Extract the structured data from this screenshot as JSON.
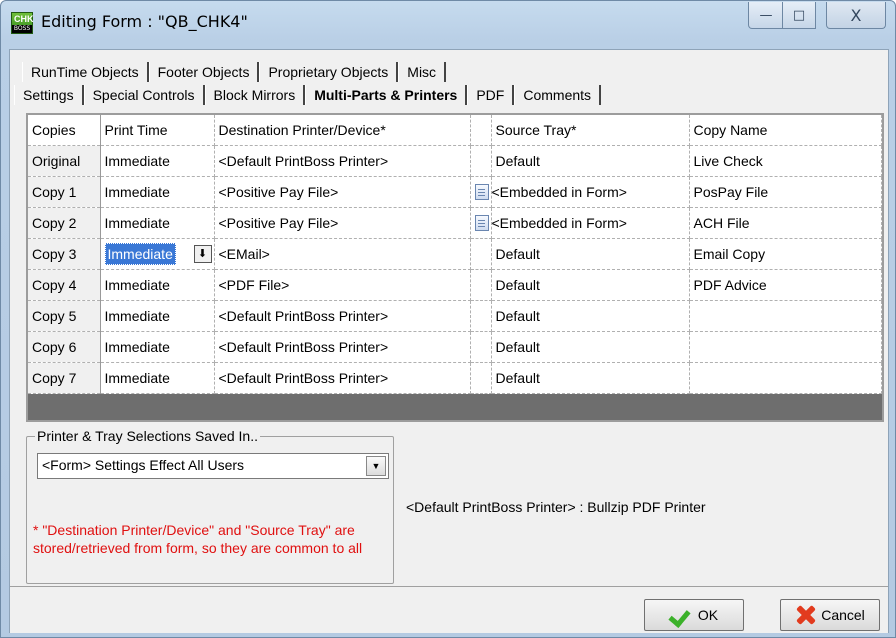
{
  "window": {
    "title": "Editing Form : \"QB_CHK4\"",
    "icon": "printboss-app-icon",
    "icon_text": "CHK",
    "icon_sub": "BOSS",
    "controls": {
      "minimize": "—",
      "maximize": "□",
      "close": "X"
    }
  },
  "tabs": {
    "row1": [
      "RunTime Objects",
      "Footer Objects",
      "Proprietary Objects",
      "Misc"
    ],
    "row2": [
      "Settings",
      "Special Controls",
      "Block Mirrors",
      "Multi-Parts & Printers",
      "PDF",
      "Comments"
    ],
    "active": "Multi-Parts & Printers"
  },
  "grid": {
    "headers": [
      "Copies",
      "Print Time",
      "Destination Printer/Device*",
      "",
      "Source Tray*",
      "Copy Name"
    ],
    "rows": [
      {
        "copy": "Original",
        "time": "Immediate",
        "dest": "<Default PrintBoss Printer>",
        "icon": "",
        "tray": "Default",
        "name": "Live Check"
      },
      {
        "copy": "Copy 1",
        "time": "Immediate",
        "dest": "<Positive Pay File>",
        "icon": "file-icon",
        "tray": "<Embedded in Form>",
        "name": "PosPay File"
      },
      {
        "copy": "Copy 2",
        "time": "Immediate",
        "dest": "<Positive Pay File>",
        "icon": "file-icon",
        "tray": "<Embedded in Form>",
        "name": "ACH File"
      },
      {
        "copy": "Copy 3",
        "time": "Immediate",
        "dest": "<EMail>",
        "icon": "",
        "tray": "Default",
        "name": "Email Copy"
      },
      {
        "copy": "Copy 4",
        "time": "Immediate",
        "dest": "<PDF File>",
        "icon": "",
        "tray": "Default",
        "name": "PDF Advice"
      },
      {
        "copy": "Copy 5",
        "time": "Immediate",
        "dest": "<Default PrintBoss Printer>",
        "icon": "",
        "tray": "Default",
        "name": ""
      },
      {
        "copy": "Copy 6",
        "time": "Immediate",
        "dest": "<Default PrintBoss Printer>",
        "icon": "",
        "tray": "Default",
        "name": ""
      },
      {
        "copy": "Copy 7",
        "time": "Immediate",
        "dest": "<Default PrintBoss Printer>",
        "icon": "",
        "tray": "Default",
        "name": ""
      }
    ],
    "selected_row_index": 3,
    "dropdown_glyph": "⬇"
  },
  "group": {
    "legend": "Printer & Tray Selections Saved In..",
    "combo_value": "<Form> Settings Effect All Users",
    "combo_arrow": "▼",
    "note": "* \"Destination Printer/Device\" and \"Source Tray\" are stored/retrieved from form, so they are common to all"
  },
  "printer_info": "<Default PrintBoss Printer> : Bullzip PDF Printer",
  "buttons": {
    "ok": "OK",
    "cancel": "Cancel"
  },
  "colors": {
    "selection": "#3a78d6",
    "note_text": "#e01010",
    "ok_check": "#3bb12a",
    "cancel_x": "#e23b1e"
  }
}
